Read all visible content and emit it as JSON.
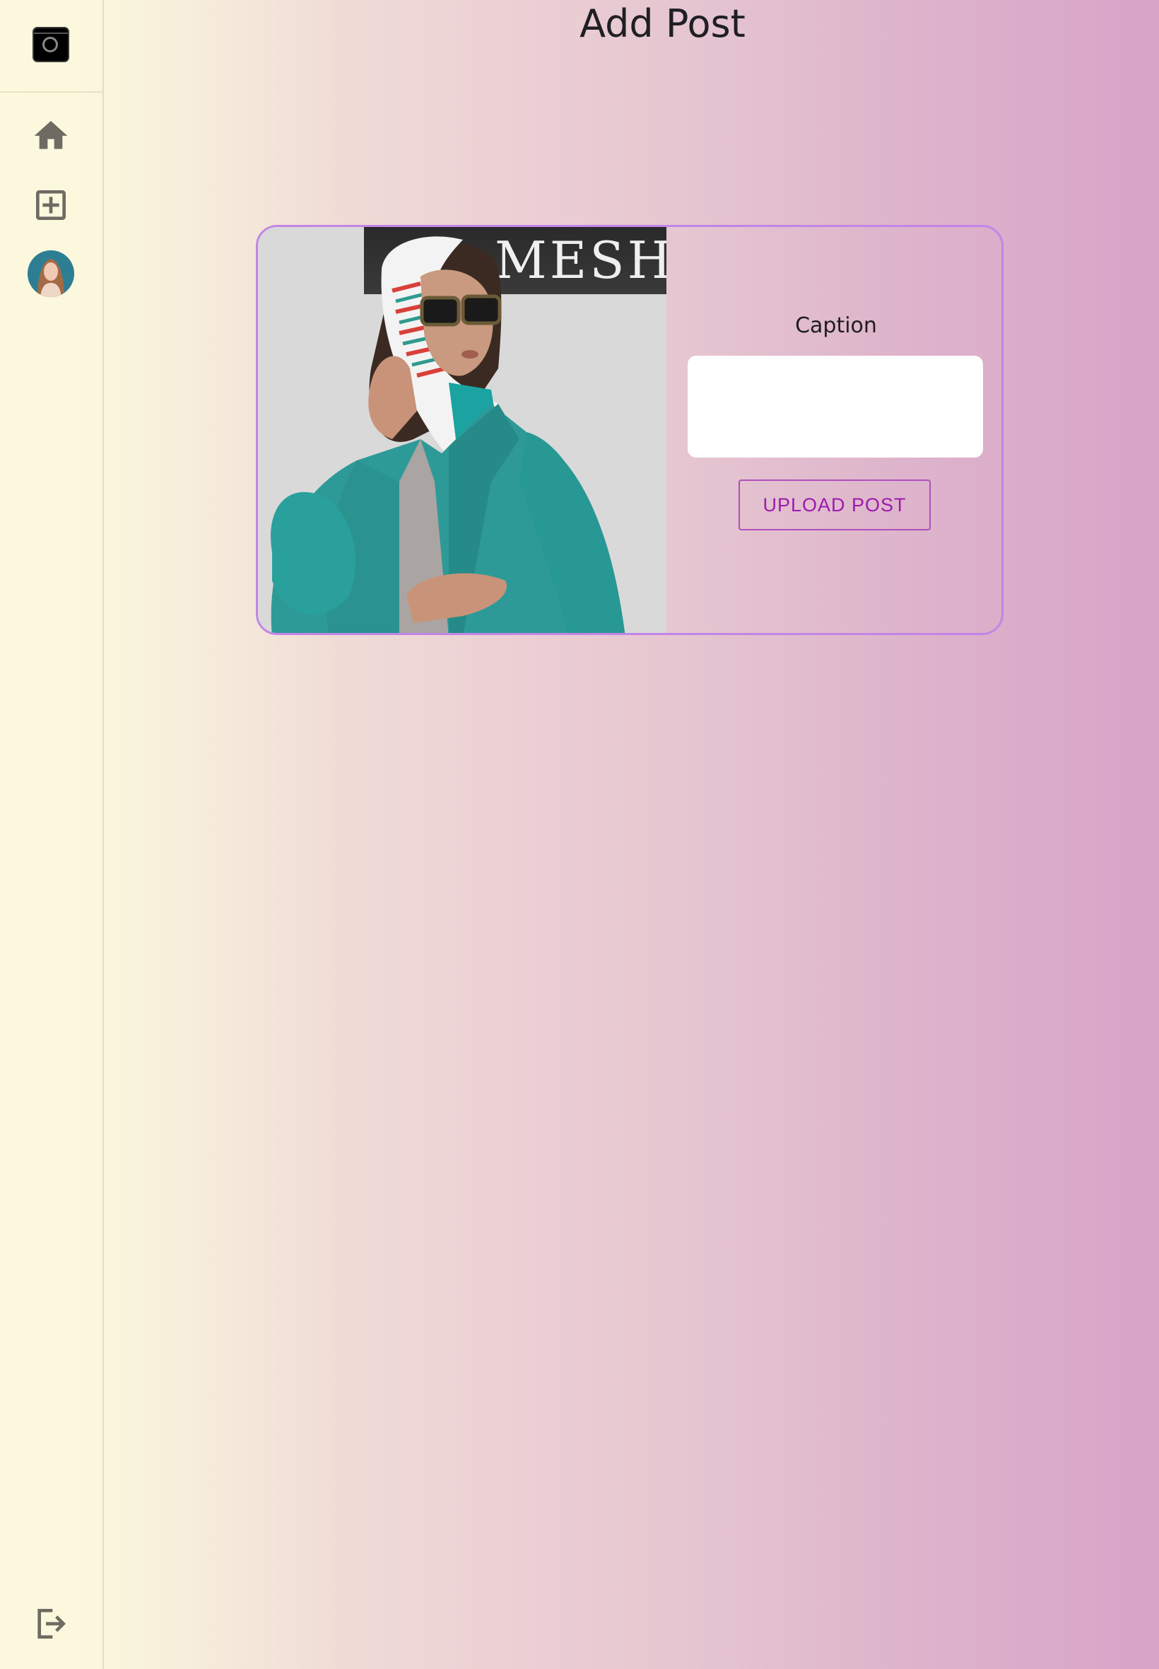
{
  "page": {
    "title": "Add Post"
  },
  "sidebar": {
    "items": [
      {
        "name": "home",
        "icon": "home-icon"
      },
      {
        "name": "add-post",
        "icon": "add-square-icon"
      },
      {
        "name": "profile",
        "icon": "avatar"
      }
    ],
    "logout_icon": "logout-icon",
    "logo_icon": "camera-logo-icon"
  },
  "post_form": {
    "caption_label": "Caption",
    "caption_value": "",
    "upload_label": "UPLOAD POST",
    "photo_sign_text": "MESH"
  },
  "colors": {
    "accent": "#c285e6",
    "button_text": "#9c1aad",
    "icon_gray": "#6f6b63"
  }
}
